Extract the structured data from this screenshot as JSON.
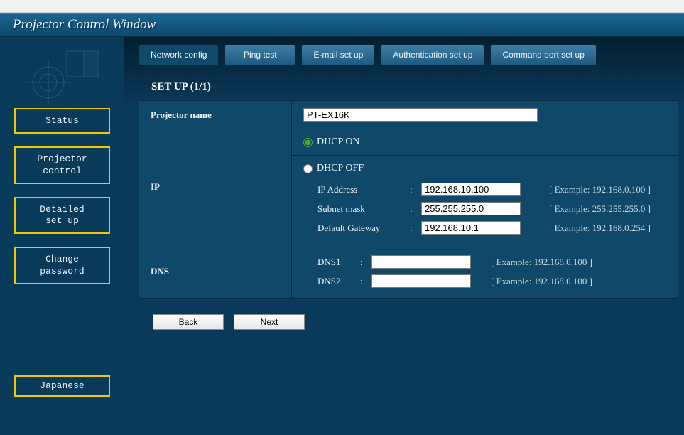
{
  "window": {
    "title": "Projector Control Window"
  },
  "sidebar": {
    "items": [
      {
        "label": "Status"
      },
      {
        "label": "Projector\ncontrol"
      },
      {
        "label": "Detailed\nset up"
      },
      {
        "label": "Change\npassword"
      }
    ],
    "language": "Japanese"
  },
  "tabs": [
    {
      "label": "Network config",
      "active": true
    },
    {
      "label": "Ping test"
    },
    {
      "label": "E-mail set up"
    },
    {
      "label": "Authentication set up"
    },
    {
      "label": "Command port set up"
    }
  ],
  "page": {
    "heading": "SET UP (1/1)"
  },
  "form": {
    "projector_name": {
      "label": "Projector name",
      "value": "PT-EX16K"
    },
    "ip": {
      "label": "IP",
      "dhcp_on_label": "DHCP ON",
      "dhcp_off_label": "DHCP OFF",
      "ip_address": {
        "label": "IP Address",
        "value": "192.168.10.100",
        "example": "[ Example: 192.168.0.100 ]"
      },
      "subnet": {
        "label": "Subnet mask",
        "value": "255.255.255.0",
        "example": "[ Example: 255.255.255.0 ]"
      },
      "gateway": {
        "label": "Default Gateway",
        "value": "192.168.10.1",
        "example": "[ Example: 192.168.0.254 ]"
      }
    },
    "dns": {
      "label": "DNS",
      "dns1": {
        "label": "DNS1",
        "value": "",
        "example": "[ Example: 192.168.0.100 ]"
      },
      "dns2": {
        "label": "DNS2",
        "value": "",
        "example": "[ Example: 192.168.0.100 ]"
      }
    }
  },
  "buttons": {
    "back": "Back",
    "next": "Next"
  }
}
